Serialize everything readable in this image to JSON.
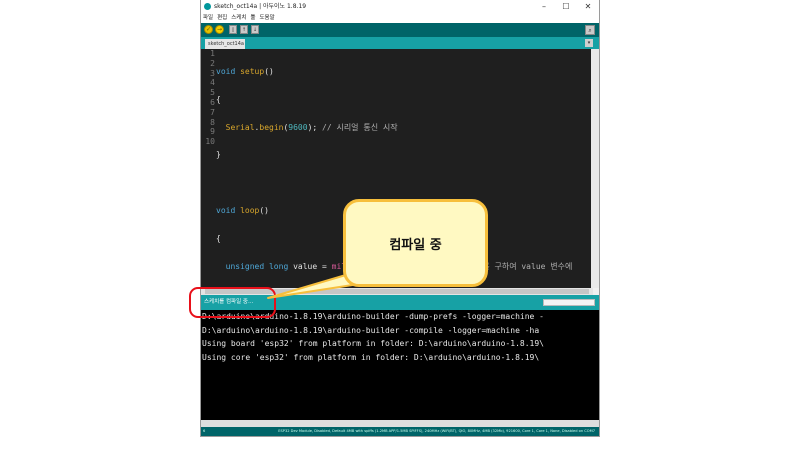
{
  "window": {
    "title": "sketch_oct14a | 아두이노 1.8.19"
  },
  "menu": [
    "파일",
    "편집",
    "스케치",
    "툴",
    "도움말"
  ],
  "toolbar": {
    "verify": "✓",
    "upload": "→",
    "new": "▯",
    "open": "↑",
    "save": "↓",
    "serial_monitor": "⌕"
  },
  "tabs": {
    "active": "sketch_oct14a",
    "menu_arrow": "▾"
  },
  "editor": {
    "line_numbers": [
      "1",
      "2",
      "3",
      "4",
      "5",
      "6",
      "7",
      "8",
      "9",
      "10"
    ]
  },
  "status": {
    "message": "스케치를 컴파일 중…"
  },
  "console": {
    "lines": [
      "D:\\arduino\\arduino-1.8.19\\arduino-builder -dump-prefs -logger=machine -",
      "D:\\arduino\\arduino-1.8.19\\arduino-builder -compile -logger=machine -ha",
      "Using board 'esp32' from platform in folder: D:\\arduino\\arduino-1.8.19\\",
      "Using core 'esp32' from platform in folder: D:\\arduino\\arduino-1.8.19\\"
    ]
  },
  "footer": {
    "line": "6",
    "board": "ESP32 Dev Module, Disabled, Default 4MB with spiffs (1.2MB APP/1.5MB SPIFFS), 240MHz (WiFi/BT), QIO, 80MHz, 4MB (32Mb), 921600, Core 1, Core 1, None, Disabled on COM7"
  },
  "callout": {
    "text": "컴파일 중"
  },
  "colors": {
    "toolbar": "#006468",
    "tabbar": "#17a1a5",
    "editor_bg": "#1f1f1f",
    "console_bg": "#000000",
    "callout_fill": "#fff9c2",
    "callout_border": "#f7bf3c",
    "highlight_ring": "#e8101a"
  }
}
